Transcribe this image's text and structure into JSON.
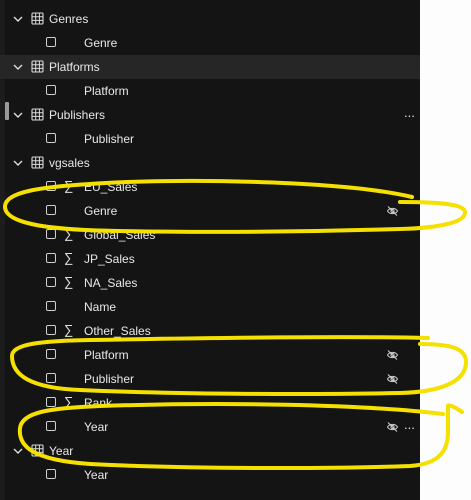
{
  "tables": [
    {
      "name": "Genres",
      "expanded": true,
      "fields": [
        {
          "label": "Genre",
          "sigma": false,
          "hidden": false
        }
      ]
    },
    {
      "name": "Platforms",
      "expanded": true,
      "selected": true,
      "fields": [
        {
          "label": "Platform",
          "sigma": false,
          "hidden": false
        }
      ]
    },
    {
      "name": "Publishers",
      "expanded": true,
      "more": "...",
      "fields": [
        {
          "label": "Publisher",
          "sigma": false,
          "hidden": false
        }
      ]
    },
    {
      "name": "vgsales",
      "expanded": true,
      "fields": [
        {
          "label": "EU_Sales",
          "sigma": true,
          "hidden": false
        },
        {
          "label": "Genre",
          "sigma": false,
          "hidden": true
        },
        {
          "label": "Global_Sales",
          "sigma": true,
          "hidden": false
        },
        {
          "label": "JP_Sales",
          "sigma": true,
          "hidden": false
        },
        {
          "label": "NA_Sales",
          "sigma": true,
          "hidden": false
        },
        {
          "label": "Name",
          "sigma": false,
          "hidden": false
        },
        {
          "label": "Other_Sales",
          "sigma": true,
          "hidden": false
        },
        {
          "label": "Platform",
          "sigma": false,
          "hidden": true
        },
        {
          "label": "Publisher",
          "sigma": false,
          "hidden": true
        },
        {
          "label": "Rank",
          "sigma": true,
          "hidden": false
        },
        {
          "label": "Year",
          "sigma": false,
          "hidden": true,
          "more": "..."
        }
      ]
    },
    {
      "name": "Year",
      "expanded": true,
      "fields": [
        {
          "label": "Year",
          "sigma": false,
          "hidden": false
        }
      ]
    }
  ],
  "colors": {
    "pane_background": "#141414",
    "selected_row": "#262626",
    "text": "#e9e9e9",
    "annotation_stroke": "#f5e000"
  },
  "icons": {
    "expand": "chevron-down-icon",
    "table": "table-icon",
    "measure": "sigma-icon",
    "hidden": "eye-off-icon",
    "more": "more-options-icon"
  }
}
